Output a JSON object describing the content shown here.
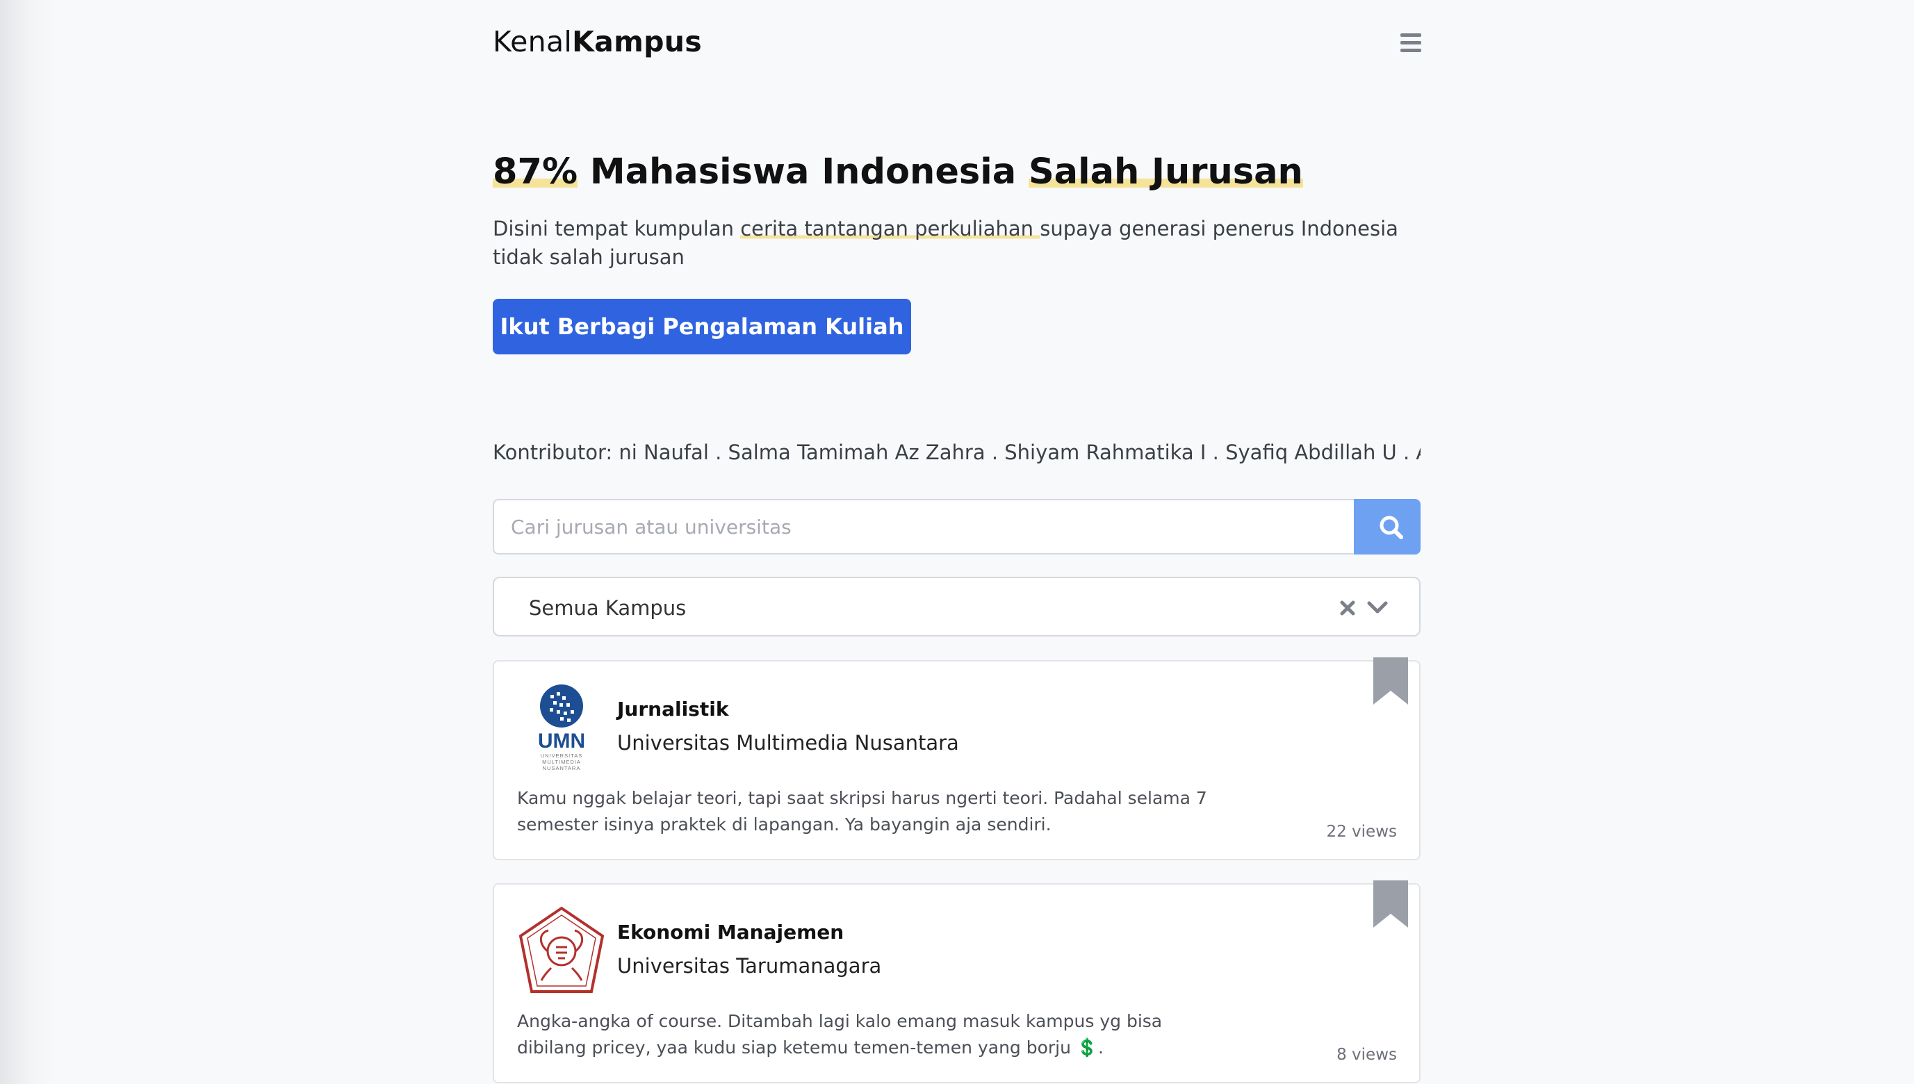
{
  "brand": {
    "light": "Kenal",
    "bold": "Kampus"
  },
  "hero": {
    "title_hl1": "87%",
    "title_mid": " Mahasiswa Indonesia ",
    "title_hl2": "Salah Jurusan",
    "desc_pre": "Disini tempat kumpulan ",
    "desc_hl": "cerita tantangan perkuliahan ",
    "desc_post": "supaya generasi penerus Indonesia tidak salah jurusan",
    "cta_label": "Ikut Berbagi Pengalaman Kuliah"
  },
  "contributors": {
    "text": "Kontributor: ni Naufal . Salma Tamimah Az Zahra . Shiyam Rahmatika I . Syafiq Abdillah U . Ade"
  },
  "search": {
    "placeholder": "Cari jurusan atau universitas"
  },
  "filter": {
    "selected": "Semua Kampus"
  },
  "cards": [
    {
      "major": "Jurnalistik",
      "university": "Universitas Multimedia Nusantara",
      "logo_text": "UMN",
      "logo_subtext": [
        "UNIVERSITAS",
        "MULTIMEDIA",
        "NUSANTARA"
      ],
      "story": "Kamu nggak belajar teori, tapi saat skripsi harus ngerti teori. Padahal selama 7 semester isinya praktek di lapangan. Ya bayangin aja sendiri.",
      "views": "22 views"
    },
    {
      "major": "Ekonomi Manajemen",
      "university": "Universitas Tarumanagara",
      "story": "Angka-angka of course. Ditambah lagi kalo emang masuk kampus yg bisa dibilang pricey, yaa kudu siap ketemu temen-temen yang borju 💲.",
      "views": "8 views"
    }
  ],
  "colors": {
    "primary": "#2f63e0",
    "search_button": "#6ea1f2",
    "highlight": "#f6e39a",
    "bookmark": "#9ba0a8"
  }
}
